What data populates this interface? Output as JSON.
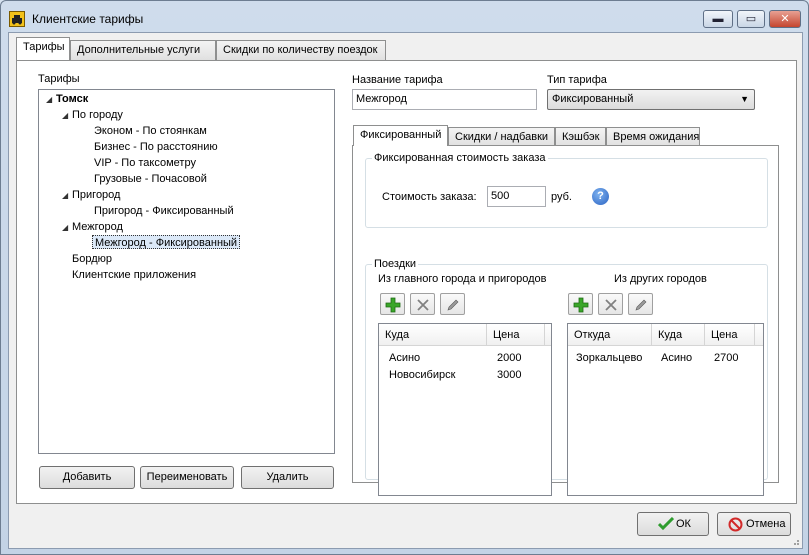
{
  "window": {
    "title": "Клиентские тарифы",
    "min": "▬",
    "max": "▭",
    "close": "✕"
  },
  "top_tabs": [
    "Тарифы",
    "Дополнительные услуги",
    "Скидки по количеству поездок"
  ],
  "tree": {
    "heading": "Тарифы",
    "nodes": [
      {
        "label": "Томск",
        "bold": true
      },
      {
        "label": "По городу"
      },
      {
        "label": "Эконом - По стоянкам"
      },
      {
        "label": "Бизнес - По расстоянию"
      },
      {
        "label": "VIP - По таксометру"
      },
      {
        "label": "Грузовые - Почасовой"
      },
      {
        "label": "Пригород"
      },
      {
        "label": "Пригород - Фиксированный"
      },
      {
        "label": "Межгород"
      },
      {
        "label": "Межгород - Фиксированный",
        "selected": true
      },
      {
        "label": "Бордюр"
      },
      {
        "label": "Клиентские приложения"
      }
    ]
  },
  "left_buttons": {
    "add": "Добавить",
    "rename": "Переименовать",
    "delete": "Удалить"
  },
  "tariff": {
    "name_label": "Название тарифа",
    "name_value": "Межгород",
    "type_label": "Тип тарифа",
    "type_value": "Фиксированный"
  },
  "inner_tabs": [
    "Фиксированный",
    "Скидки / надбавки",
    "Кэшбэк",
    "Время ожидания"
  ],
  "fixed": {
    "group_title": "Фиксированная стоимость заказа",
    "cost_label": "Стоимость заказа:",
    "cost_value": "500",
    "unit": "руб.",
    "help": "?"
  },
  "trips": {
    "group_title": "Поездки",
    "from_main": {
      "title": "Из главного города и пригородов",
      "columns": [
        "Куда",
        "Цена"
      ],
      "rows": [
        [
          "Асино",
          "2000"
        ],
        [
          "Новосибирск",
          "3000"
        ]
      ]
    },
    "from_other": {
      "title": "Из других городов",
      "columns": [
        "Откуда",
        "Куда",
        "Цена"
      ],
      "rows": [
        [
          "Зоркальцево",
          "Асино",
          "2700"
        ]
      ]
    }
  },
  "footer": {
    "ok": "ОК",
    "cancel": "Отмена"
  },
  "colors": {
    "add_green": "#3aa629",
    "ok_green": "#2e9c2e",
    "cancel_red": "#d22a2a"
  }
}
